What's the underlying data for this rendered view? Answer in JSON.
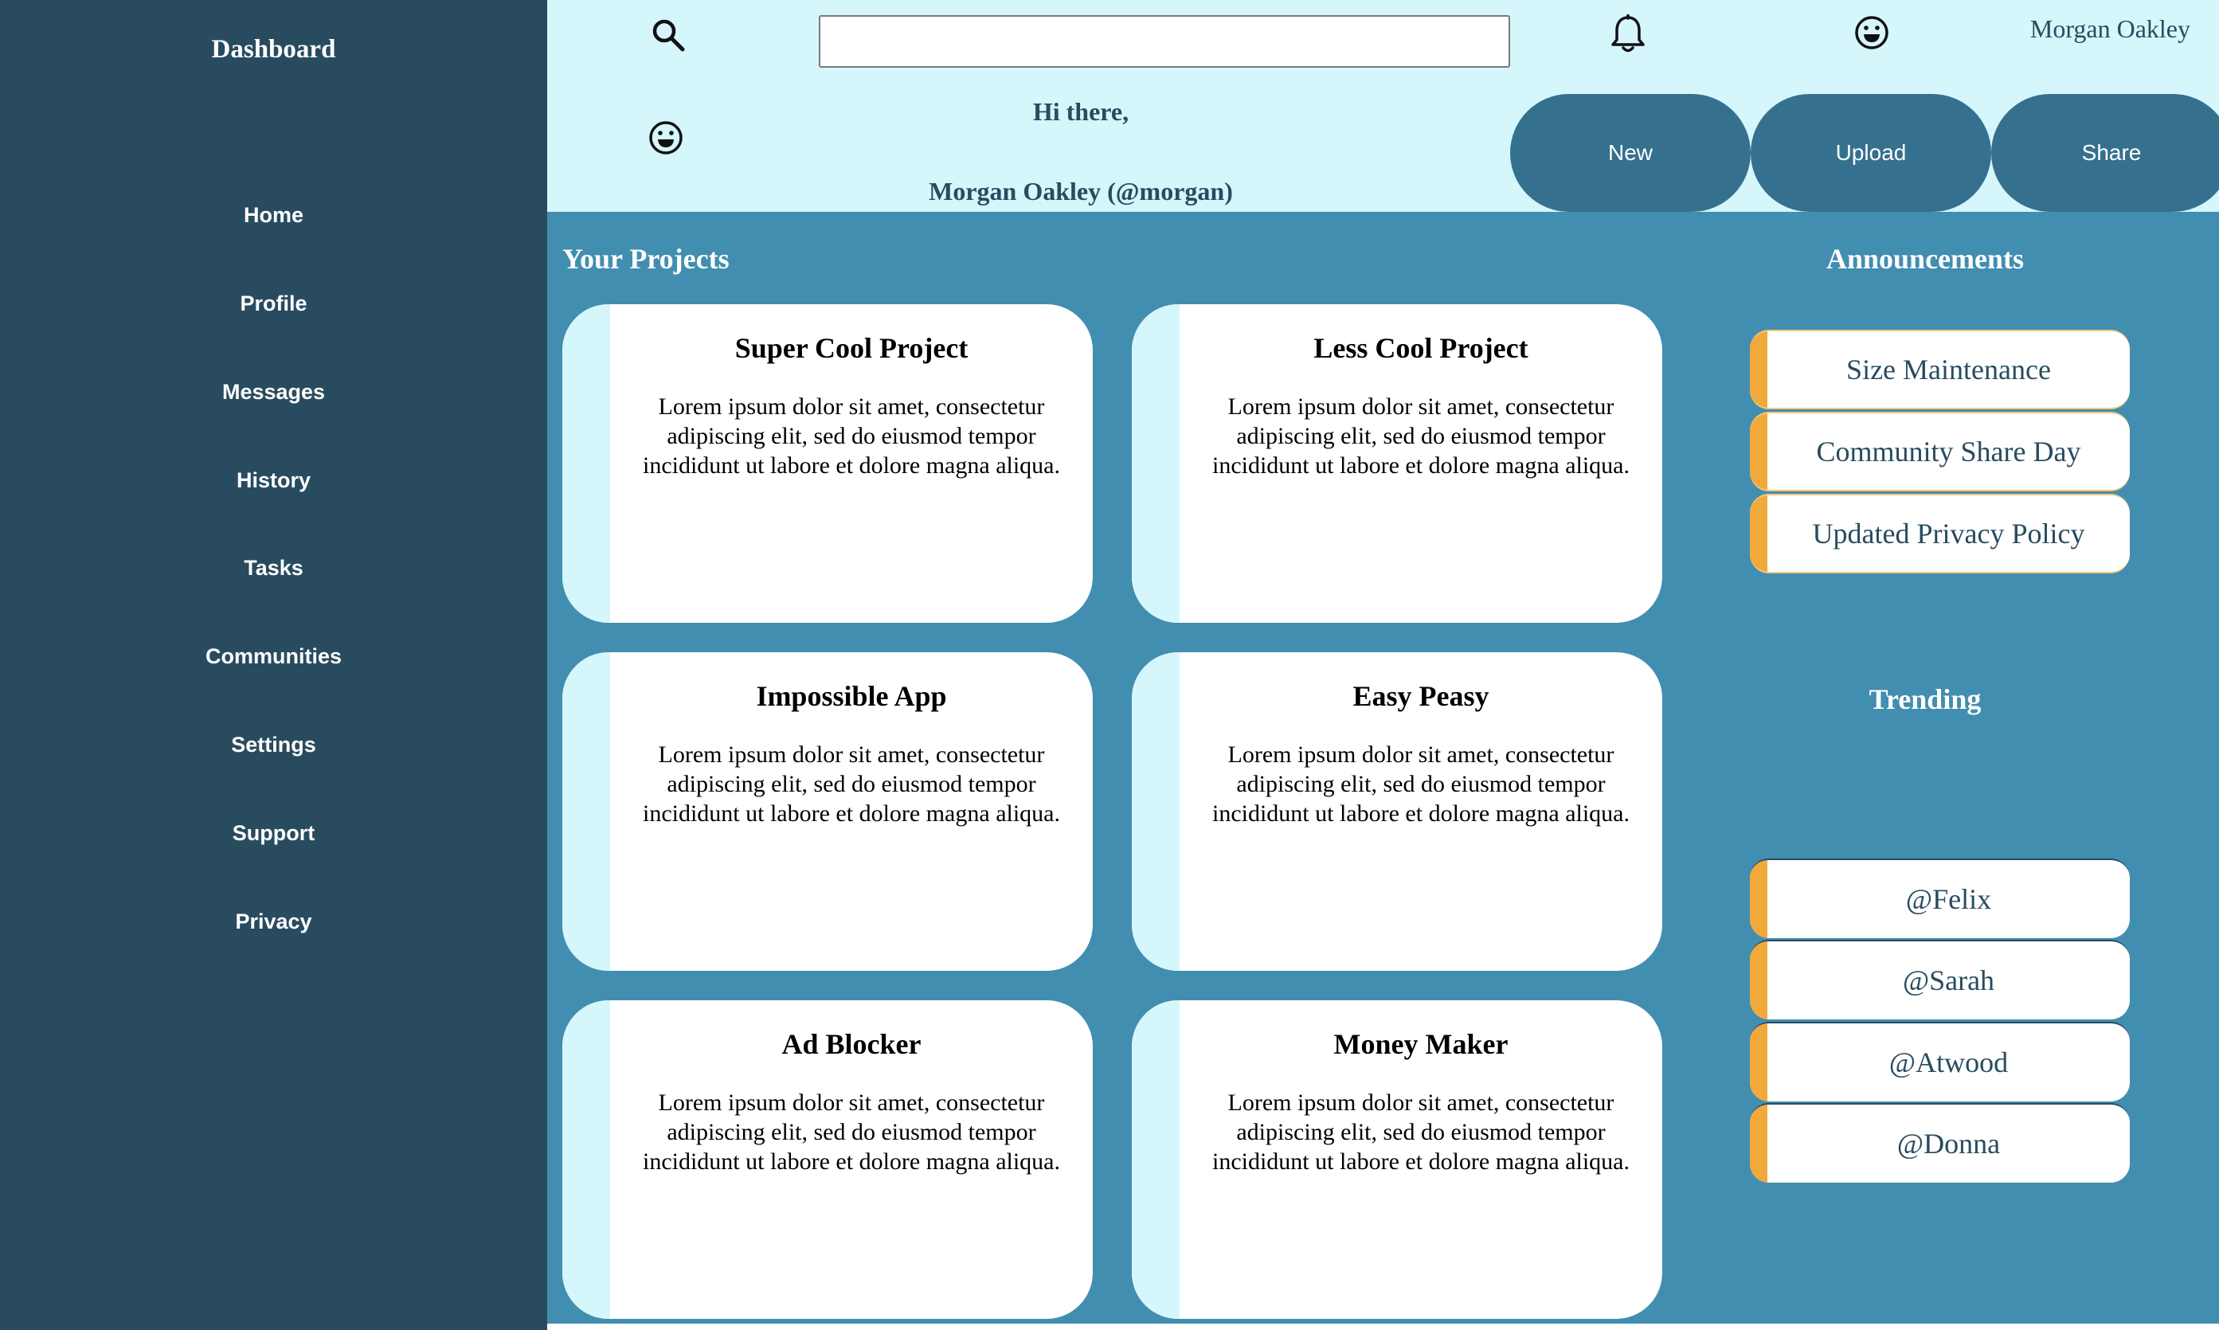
{
  "sidebar": {
    "title": "Dashboard",
    "items": [
      {
        "label": "Home"
      },
      {
        "label": "Profile"
      },
      {
        "label": "Messages"
      },
      {
        "label": "History"
      },
      {
        "label": "Tasks"
      },
      {
        "label": "Communities"
      },
      {
        "label": "Settings"
      },
      {
        "label": "Support"
      },
      {
        "label": "Privacy"
      }
    ]
  },
  "header": {
    "search": {
      "value": "",
      "placeholder": ""
    },
    "user_name": "Morgan Oakley",
    "greeting": "Hi there,",
    "user_handle": "Morgan Oakley (@morgan)",
    "buttons": {
      "new": "New",
      "upload": "Upload",
      "share": "Share"
    },
    "icons": {
      "search": "search-icon",
      "bell": "bell-icon",
      "avatar": "smile-icon"
    }
  },
  "projects": {
    "title": "Your Projects",
    "cards": [
      {
        "title": "Super Cool Project",
        "desc": "Lorem ipsum dolor sit amet, consectetur adipiscing elit, sed do eiusmod tempor incididunt ut labore et dolore magna aliqua."
      },
      {
        "title": "Less Cool Project",
        "desc": "Lorem ipsum dolor sit amet, consectetur adipiscing elit, sed do eiusmod tempor incididunt ut labore et dolore magna aliqua."
      },
      {
        "title": "Impossible App",
        "desc": "Lorem ipsum dolor sit amet, consectetur adipiscing elit, sed do eiusmod tempor incididunt ut labore et dolore magna aliqua."
      },
      {
        "title": "Easy Peasy",
        "desc": "Lorem ipsum dolor sit amet, consectetur adipiscing elit, sed do eiusmod tempor incididunt ut labore et dolore magna aliqua."
      },
      {
        "title": "Ad Blocker",
        "desc": "Lorem ipsum dolor sit amet, consectetur adipiscing elit, sed do eiusmod tempor incididunt ut labore et dolore magna aliqua."
      },
      {
        "title": "Money Maker",
        "desc": "Lorem ipsum dolor sit amet, consectetur adipiscing elit, sed do eiusmod tempor incididunt ut labore et dolore magna aliqua."
      }
    ]
  },
  "announcements": {
    "title": "Announcements",
    "items": [
      {
        "label": "Size Maintenance"
      },
      {
        "label": "Community Share Day"
      },
      {
        "label": "Updated Privacy Policy"
      }
    ]
  },
  "trending": {
    "title": "Trending",
    "items": [
      {
        "label": "@Felix"
      },
      {
        "label": "@Sarah"
      },
      {
        "label": "@Atwood"
      },
      {
        "label": "@Donna"
      }
    ]
  },
  "colors": {
    "sidebar": "#284b5f",
    "header": "#d5f6fb",
    "main": "#428eb0",
    "button": "#35718e",
    "accent": "#f2a93b"
  }
}
